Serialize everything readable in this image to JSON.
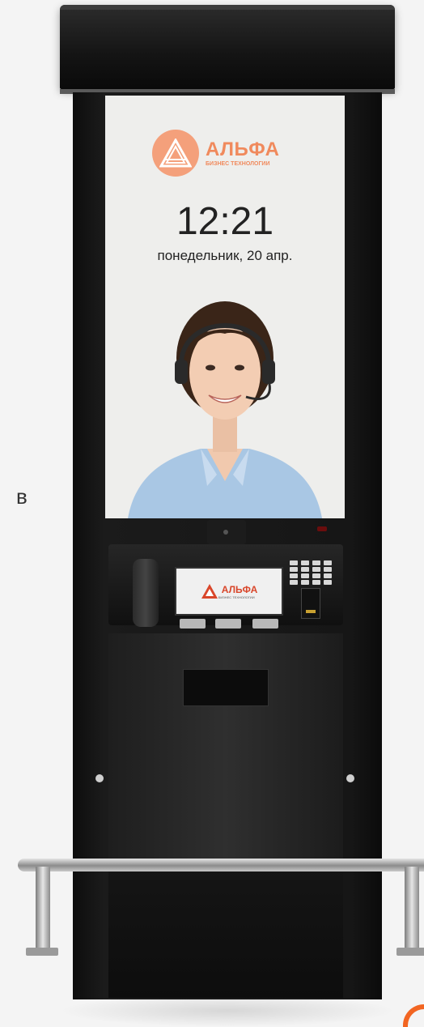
{
  "side_text": "в",
  "screen": {
    "logo_name": "АЛЬФА",
    "logo_sub": "БИЗНЕС ТЕХНОЛОГИИ",
    "time": "12:21",
    "date": "понедельник, 20 апр."
  },
  "console": {
    "mini_logo_name": "АЛЬФА",
    "mini_logo_sub": "БИЗНЕС ТЕХНОЛОГИИ"
  },
  "colors": {
    "brand_orange": "#f08a5d",
    "kiosk_black": "#141414"
  },
  "icons": [
    "alfa-logo-icon",
    "headset-operator-image",
    "camera-icon",
    "phone-handset-icon",
    "keypad-icon",
    "card-reader-icon"
  ]
}
